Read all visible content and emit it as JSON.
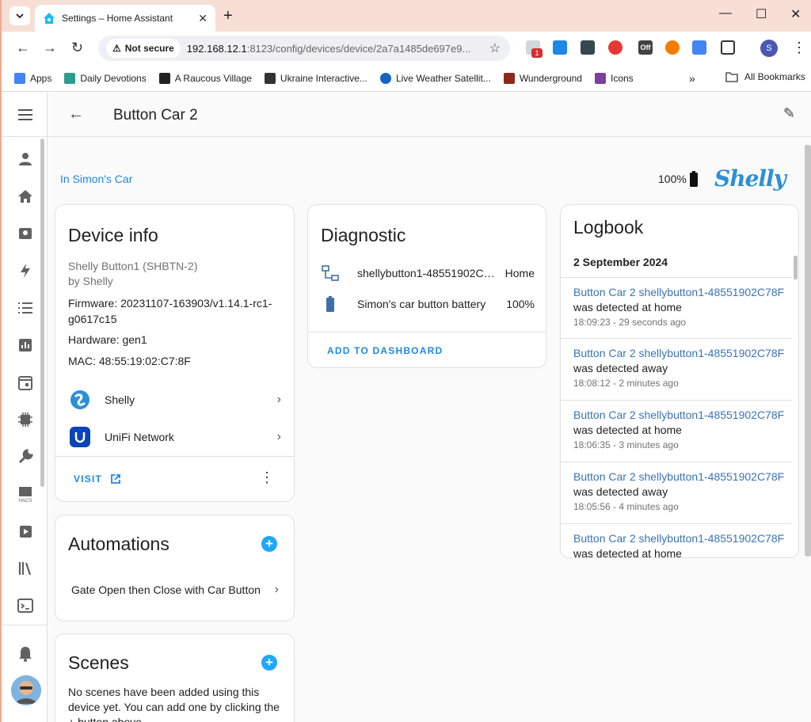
{
  "browser": {
    "tab_title": "Settings – Home Assistant",
    "not_secure": "Not secure",
    "url_host": "192.168.12.1",
    "url_rest": ":8123/config/devices/device/2a7a1485de697e9...",
    "ext_badge_count": "1",
    "ext_off_label": "Off",
    "profile_initial": "S",
    "bookmarks": [
      {
        "label": "Apps",
        "color": "#4285f4"
      },
      {
        "label": "Daily Devotions",
        "color": "#2a9d8f"
      },
      {
        "label": "A Raucous Village",
        "color": "#222222"
      },
      {
        "label": "Ukraine Interactive...",
        "color": "#333333"
      },
      {
        "label": "Live Weather Satellit...",
        "color": "#1565c0"
      },
      {
        "label": "Wunderground",
        "color": "#8b2a1a"
      },
      {
        "label": "Icons",
        "color": "#7b3fa0"
      }
    ],
    "all_bookmarks": "All Bookmarks"
  },
  "header": {
    "title": "Button Car 2"
  },
  "device": {
    "area": "In Simon's Car",
    "battery": "100%",
    "brand_logo": "Shelly"
  },
  "device_info": {
    "heading": "Device info",
    "model": "Shelly Button1 (SHBTN-2)",
    "manufacturer": "by Shelly",
    "firmware": "Firmware: 20231107-163903/v1.14.1-rc1-g0617c15",
    "hardware": "Hardware: gen1",
    "mac": "MAC: 48:55:19:02:C7:8F",
    "integrations": [
      {
        "label": "Shelly",
        "icon": "shelly-icon"
      },
      {
        "label": "UniFi Network",
        "icon": "unifi-icon"
      }
    ],
    "visit_label": "VISIT"
  },
  "diagnostic": {
    "heading": "Diagnostic",
    "rows": [
      {
        "name": "shellybutton1-48551902C7...",
        "value": "Home",
        "icon": "network-icon"
      },
      {
        "name": "Simon's car button battery",
        "value": "100%",
        "icon": "battery-icon"
      }
    ],
    "add_label": "ADD TO DASHBOARD"
  },
  "logbook": {
    "heading": "Logbook",
    "date": "2 September 2024",
    "entries": [
      {
        "entity": "Button Car 2 shellybutton1-48551902C78F",
        "message": "was detected at home",
        "time": "18:09:23 - 29 seconds ago"
      },
      {
        "entity": "Button Car 2 shellybutton1-48551902C78F",
        "message": "was detected away",
        "time": "18:08:12 - 2 minutes ago"
      },
      {
        "entity": "Button Car 2 shellybutton1-48551902C78F",
        "message": "was detected at home",
        "time": "18:06:35 - 3 minutes ago"
      },
      {
        "entity": "Button Car 2 shellybutton1-48551902C78F",
        "message": "was detected away",
        "time": "18:05:56 - 4 minutes ago"
      },
      {
        "entity": "Button Car 2 shellybutton1-48551902C78F",
        "message": "was detected at home",
        "time": ""
      }
    ]
  },
  "automations": {
    "heading": "Automations",
    "items": [
      "Gate Open then Close with Car Button"
    ]
  },
  "scenes": {
    "heading": "Scenes",
    "empty_text": "No scenes have been added using this device yet. You can add one by clicking the + button above."
  },
  "colors": {
    "accent": "#1e88e5",
    "fab": "#1ea7fd",
    "chrome_titlebar": "#f7dfd6"
  }
}
